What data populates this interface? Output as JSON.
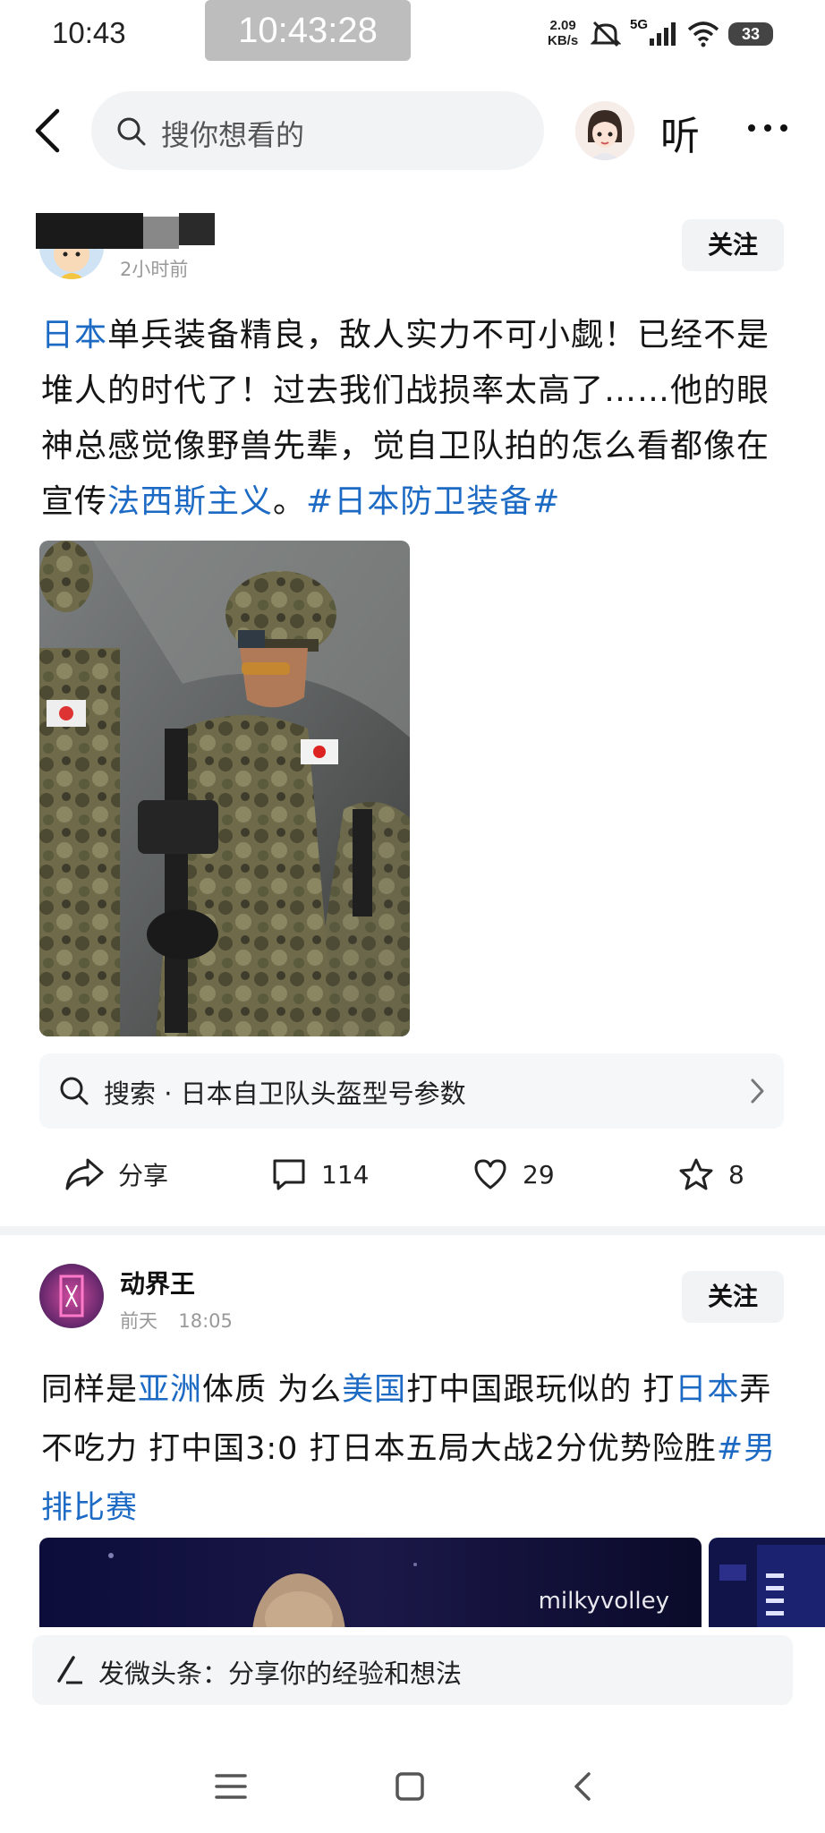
{
  "status_bar": {
    "time": "10:43",
    "clock_overlay": "10:43:28",
    "net_rate_top": "2.09",
    "net_rate_bottom": "KB/s",
    "signal": "5G",
    "battery": "33"
  },
  "top_bar": {
    "search_placeholder": "搜你想看的",
    "listen_label": "听"
  },
  "posts": [
    {
      "author": "",
      "time": "2小时前",
      "follow_label": "关注",
      "text_segments": [
        {
          "text": "日本",
          "link": true
        },
        {
          "text": "单兵装备精良，敌人实力不可小觑！已经不是堆人的时代了！过去我们战损率太高了……他的眼神总感觉像野兽先辈，觉自卫队拍的怎么看都像在宣传",
          "link": false
        },
        {
          "text": "法西斯主义",
          "link": true
        },
        {
          "text": "。",
          "link": false
        },
        {
          "text": "#日本防卫装备#",
          "link": true
        }
      ],
      "search_suggestion": "搜索 · 日本自卫队头盔型号参数",
      "actions": {
        "share_label": "分享",
        "comments": "114",
        "likes": "29",
        "favorites": "8"
      }
    },
    {
      "author": "动界王",
      "time_day": "前天",
      "time_clock": "18:05",
      "follow_label": "关注",
      "text_segments": [
        {
          "text": "同样是",
          "link": false
        },
        {
          "text": "亚洲",
          "link": true
        },
        {
          "text": "体质 为么",
          "link": false
        },
        {
          "text": "美国",
          "link": true
        },
        {
          "text": "打中国跟玩似的 打",
          "link": false
        },
        {
          "text": "日本",
          "link": true
        },
        {
          "text": "弄不吃力  打中国3:0  打日本五局大战2分优势险胜",
          "link": false
        },
        {
          "text": "#男排比赛",
          "link": true
        }
      ],
      "image_watermark": "milkyvolley"
    }
  ],
  "compose_bar": {
    "placeholder": "发微头条：分享你的经验和想法"
  },
  "colors": {
    "link": "#1c6ac4",
    "background": "#ffffff",
    "card_gray": "#f2f3f5"
  }
}
